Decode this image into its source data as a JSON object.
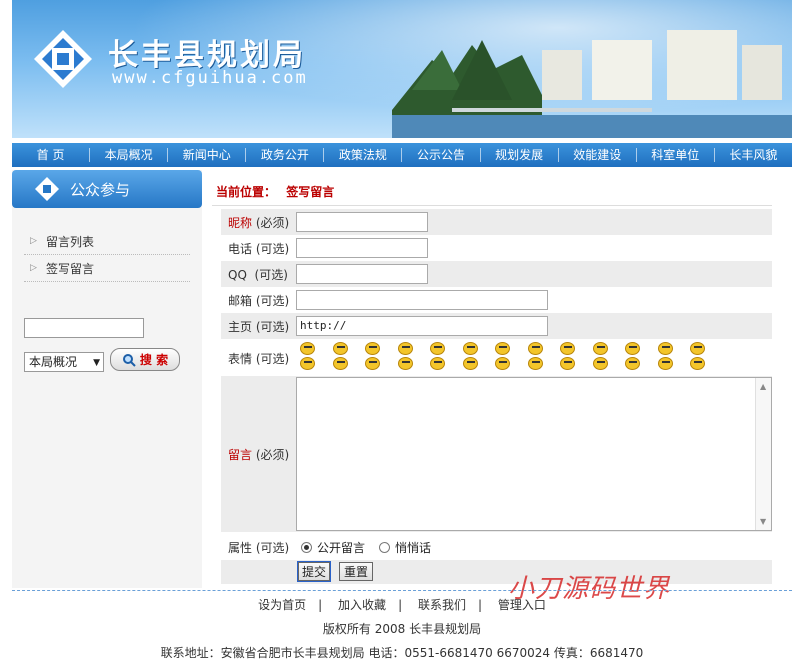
{
  "header": {
    "site_name": "长丰县规划局",
    "site_url": "www.cfguihua.com"
  },
  "nav": [
    "首 页",
    "本局概况",
    "新闻中心",
    "政务公开",
    "政策法规",
    "公示公告",
    "规划发展",
    "效能建设",
    "科室单位",
    "长丰风貌"
  ],
  "sidebar": {
    "title": "公众参与",
    "items": [
      {
        "label": "留言列表"
      },
      {
        "label": "签写留言"
      }
    ],
    "search_value": "",
    "category_selected": "本局概况",
    "search_button": "搜 索"
  },
  "breadcrumb": {
    "prefix": "当前位置：",
    "current": "签写留言"
  },
  "form": {
    "nickname": {
      "label_main": "昵称",
      "label_note": "(必须)",
      "value": ""
    },
    "phone": {
      "label": "电话 (可选)",
      "value": ""
    },
    "qq": {
      "label": "QQ  (可选)",
      "value": ""
    },
    "email": {
      "label": "邮箱 (可选)",
      "value": ""
    },
    "homepage": {
      "label": "主页 (可选)",
      "value": "http://"
    },
    "emotion": {
      "label": "表情 (可选)",
      "count": 26
    },
    "message": {
      "label_main": "留言",
      "label_note": "(必须)",
      "value": ""
    },
    "visibility": {
      "label": "属性 (可选)",
      "options": [
        {
          "label": "公开留言",
          "selected": true
        },
        {
          "label": "悄悄话",
          "selected": false
        }
      ]
    },
    "submit_label": "提交",
    "reset_label": "重置"
  },
  "watermark": "小刀源码世界",
  "footer": {
    "links": [
      "设为首页",
      "加入收藏",
      "联系我们",
      "管理入口"
    ],
    "copyright": "版权所有 2008 长丰县规划局",
    "address": "联系地址：安徽省合肥市长丰县规划局 电话：0551-6681470 6670024 传真：6681470"
  },
  "colors": {
    "nav": "#1f6fbf",
    "required": "#bb0000",
    "accent": "#2677c6"
  }
}
